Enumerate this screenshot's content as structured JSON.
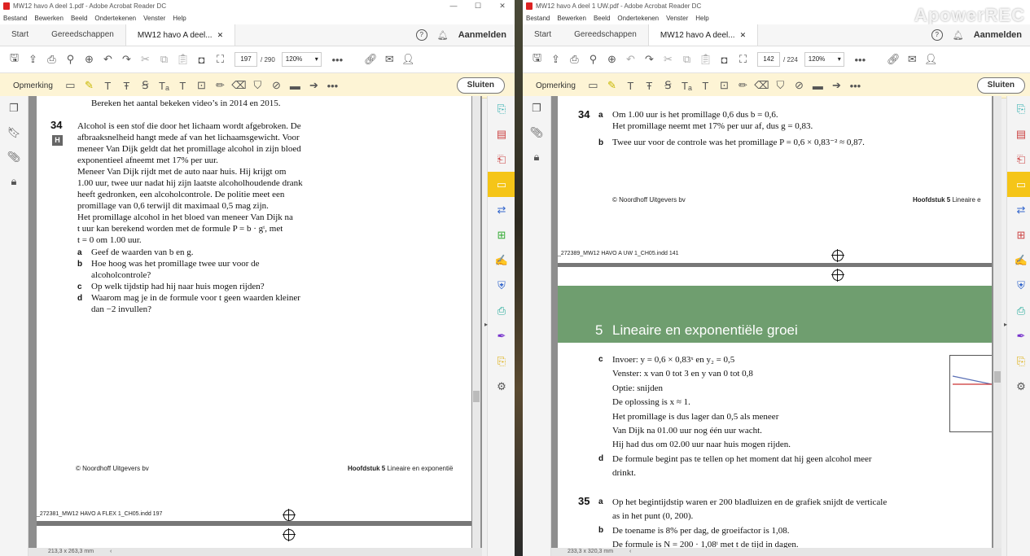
{
  "left": {
    "title": "MW12 havo A deel 1.pdf - Adobe Acrobat Reader DC",
    "menu": [
      "Bestand",
      "Bewerken",
      "Beeld",
      "Ondertekenen",
      "Venster",
      "Help"
    ],
    "tabs": {
      "start": "Start",
      "tools": "Gereedschappen",
      "doc": "MW12 havo A deel...",
      "signin": "Aanmelden"
    },
    "page_current": "197",
    "page_total": "/ 290",
    "zoom": "120%",
    "comment_label": "Opmerking",
    "close_label": "Sluiten",
    "top_text": "Bereken het aantal bekeken video’s in 2014 en 2015.",
    "q34": {
      "num": "34",
      "badge": "H",
      "lines": [
        "Alcohol is een stof die door het lichaam wordt afgebroken. De",
        "afbraaksnelheid hangt mede af van het lichaamsgewicht. Voor",
        "meneer Van Dijk geldt dat het promillage alcohol in zijn bloed",
        "exponentieel afneemt met 17% per uur.",
        "Meneer Van Dijk rijdt met de auto naar huis. Hij krijgt om",
        "1.00 uur, twee uur nadat hij zijn laatste alcoholhoudende drank",
        "heeft gedronken, een alcoholcontrole. De politie meet een",
        "promillage van 0,6 terwijl dit maximaal 0,5 mag zijn.",
        "Het promillage alcohol in het bloed van meneer Van Dijk na",
        "t uur kan berekend worden met de formule P = b · gᵗ, met",
        "t = 0 om 1.00 uur."
      ],
      "parts": [
        {
          "letter": "a",
          "lines": [
            "Geef de waarden van b en g."
          ]
        },
        {
          "letter": "b",
          "lines": [
            "Hoe hoog was het promillage twee uur voor de",
            "alcoholcontrole?"
          ]
        },
        {
          "letter": "c",
          "lines": [
            "Op welk tijdstip had hij naar huis mogen rijden?"
          ]
        },
        {
          "letter": "d",
          "lines": [
            "Waarom mag je in de formule voor t geen waarden kleiner",
            "dan −2 invullen?"
          ]
        }
      ]
    },
    "footer_left": "© Noordhoff Uitgevers bv",
    "footer_right_bold": "Hoofdstuk 5",
    "footer_right": " Lineaire en exponentië",
    "slug": "_272381_MW12 HAVO A FLEX 1_CH05.indd   197",
    "dimensions": "213,3 x 263,3 mm"
  },
  "right": {
    "title": "MW12 havo A deel 1 UW.pdf - Adobe Acrobat Reader DC",
    "menu": [
      "Bestand",
      "Bewerken",
      "Beeld",
      "Ondertekenen",
      "Venster",
      "Help"
    ],
    "tabs": {
      "start": "Start",
      "tools": "Gereedschappen",
      "doc": "MW12 havo A deel...",
      "signin": "Aanmelden"
    },
    "page_current": "142",
    "page_total": "/ 224",
    "zoom": "120%",
    "comment_label": "Opmerking",
    "close_label": "Sluiten",
    "watermark": "ApowerREC",
    "a34": {
      "num": "34",
      "a_lines": [
        "Om 1.00 uur is het promillage 0,6 dus b = 0,6.",
        "Het promillage neemt met 17% per uur af, dus g = 0,83."
      ],
      "b_lines": [
        "Twee uur voor de controle was het promillage P = 0,6 × 0,83⁻² ≈ 0,87."
      ]
    },
    "footer_left": "© Noordhoff Uitgevers bv",
    "footer_right_bold": "Hoofdstuk 5",
    "footer_right": " Lineaire e",
    "slug": "_272389_MW12 HAVO A UW 1_CH05.indd   141",
    "chapter_num": "5",
    "chapter_title": "Lineaire en exponentiële groei",
    "c_lines": [
      "Invoer: y = 0,6 × 0,83ˣ en y₂ = 0,5",
      "Venster: x van 0 tot 3 en y van 0 tot 0,8",
      "Optie: snijden",
      "De oplossing is x ≈ 1.",
      "Het promillage is dus lager dan 0,5 als meneer",
      "Van Dijk na 01.00 uur nog één uur wacht.",
      "Hij had dus om 02.00 uur naar huis mogen rijden."
    ],
    "d_lines": [
      "De formule begint pas te tellen op het moment dat hij geen alcohol meer",
      "drinkt."
    ],
    "a35": {
      "num": "35",
      "a_lines": [
        "Op het begintijdstip waren er 200 bladluizen en de grafiek snijdt de verticale",
        "as in het punt (0, 200)."
      ],
      "b_lines": [
        "De toename is 8% per dag, de groeifactor is 1,08.",
        "De formule is N = 200 · 1,08ᵗ met t de tijd in dagen."
      ]
    },
    "dimensions": "233,3 x 320,3 mm"
  }
}
